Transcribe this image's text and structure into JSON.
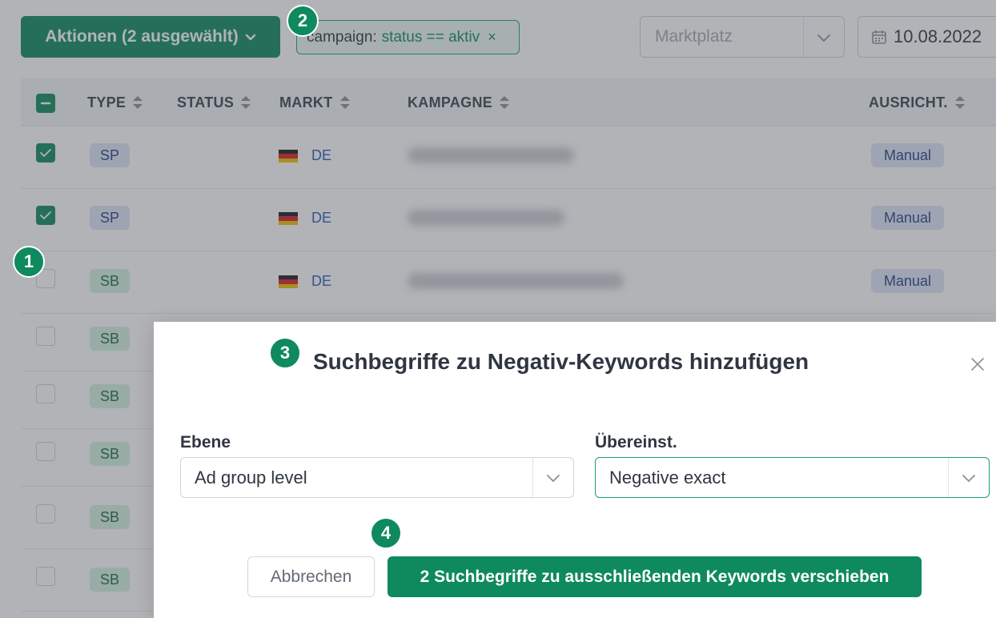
{
  "toolbar": {
    "actions_label": "Aktionen (2 ausgewählt)",
    "filter": {
      "key": "campaign:",
      "value": "status == aktiv",
      "remove": "×"
    },
    "marketplace_placeholder": "Marktplatz",
    "date": "10.08.2022"
  },
  "table": {
    "headers": {
      "type": "TYPE",
      "status": "STATUS",
      "markt": "MARKT",
      "kampagne": "KAMPAGNE",
      "ausricht": "AUSRICHT."
    },
    "rows": [
      {
        "type": "SP",
        "markt": "DE",
        "ausricht": "Manual"
      },
      {
        "type": "SP",
        "markt": "DE",
        "ausricht": "Manual"
      },
      {
        "type": "SB",
        "markt": "DE",
        "ausricht": "Manual"
      },
      {
        "type": "SB"
      },
      {
        "type": "SB"
      },
      {
        "type": "SB"
      },
      {
        "type": "SB"
      },
      {
        "type": "SB"
      }
    ]
  },
  "modal": {
    "title": "Suchbegriffe zu Negativ-Keywords hinzufügen",
    "ebene_label": "Ebene",
    "ebene_value": "Ad group level",
    "match_label": "Übereinst.",
    "match_value": "Negative exact",
    "cancel_label": "Abbrechen",
    "submit_label": "2 Suchbegriffe zu ausschließenden Keywords verschieben"
  },
  "steps": [
    "1",
    "2",
    "3",
    "4"
  ],
  "colors": {
    "accent": "#0e8a5e",
    "accent_light": "#d6f1e2",
    "blue_badge": "#dfe6f7",
    "link": "#2a5ab8"
  },
  "icons": [
    "chevron-down-icon",
    "sort-icon",
    "calendar-icon",
    "checkmark-icon",
    "minus-icon",
    "germany-flag-icon",
    "close-icon"
  ]
}
